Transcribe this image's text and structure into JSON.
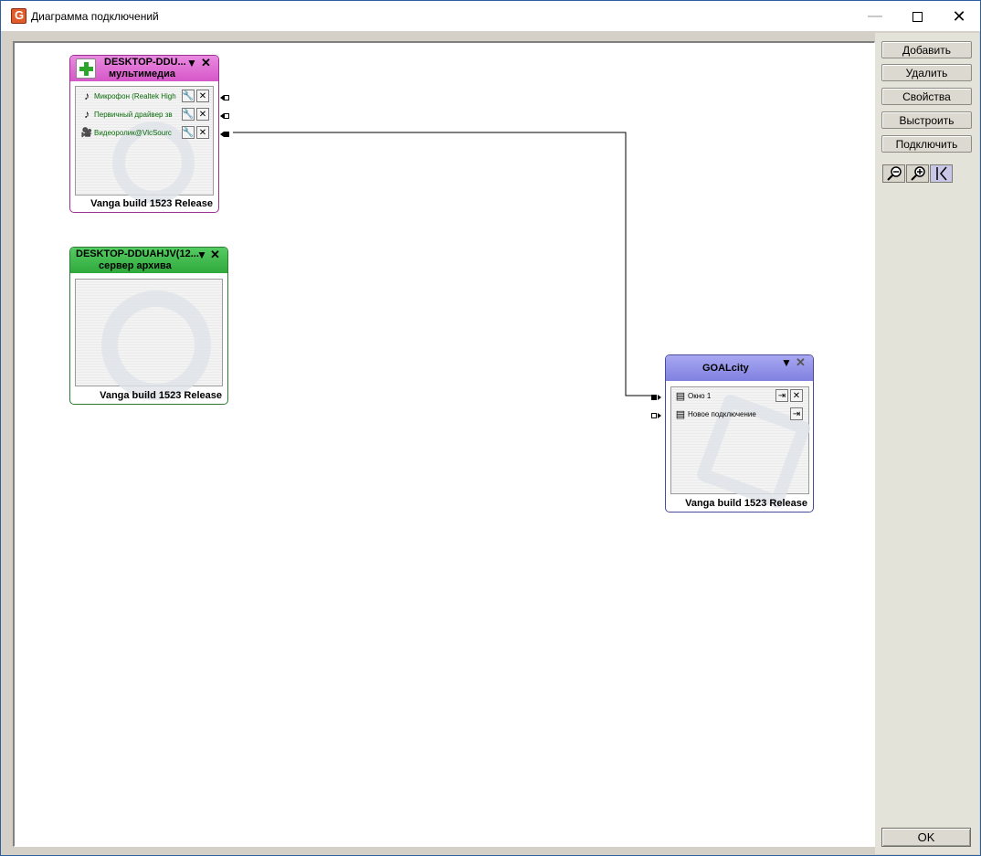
{
  "window": {
    "title": "Диаграмма подключений",
    "minimize_icon": "minimize-icon",
    "maximize_icon": "maximize-icon",
    "close_icon": "close-icon"
  },
  "side_buttons": {
    "add": "Добавить",
    "delete": "Удалить",
    "properties": "Свойства",
    "arrange": "Выстроить",
    "connect": "Подключить",
    "ok": "OK"
  },
  "tools": [
    "zoom-out-icon",
    "zoom-in-icon",
    "pointer-mode-icon"
  ],
  "nodes": {
    "multimedia": {
      "title": "DESKTOP-DDU...",
      "subtitle": "мультимедиа",
      "header_color": "#e070d0",
      "footer": "Vanga build  1523 Release",
      "rows": [
        {
          "icon": "music-note-icon",
          "label": "Микрофон (Realtek High"
        },
        {
          "icon": "music-note-icon",
          "label": "Первичный драйвер зв"
        },
        {
          "icon": "video-camera-icon",
          "label": "Видеоролик@VlcSourc"
        }
      ]
    },
    "archive": {
      "title": "DESKTOP-DDUAHJV(12...",
      "subtitle": "сервер архива",
      "header_color": "#3cb84c",
      "footer": "Vanga build  1523 Release"
    },
    "goalcity": {
      "title": "GOALcity",
      "header_color": "#8e8ee6",
      "footer": "Vanga build  1523 Release",
      "rows": [
        {
          "icon": "monitor-window-icon",
          "label": "Окно 1"
        },
        {
          "icon": "monitor-window-icon",
          "label": "Новое подключение"
        }
      ]
    }
  },
  "colors": {
    "link_green": "#0a6a0a",
    "panel_bg": "#e4e3d9"
  }
}
